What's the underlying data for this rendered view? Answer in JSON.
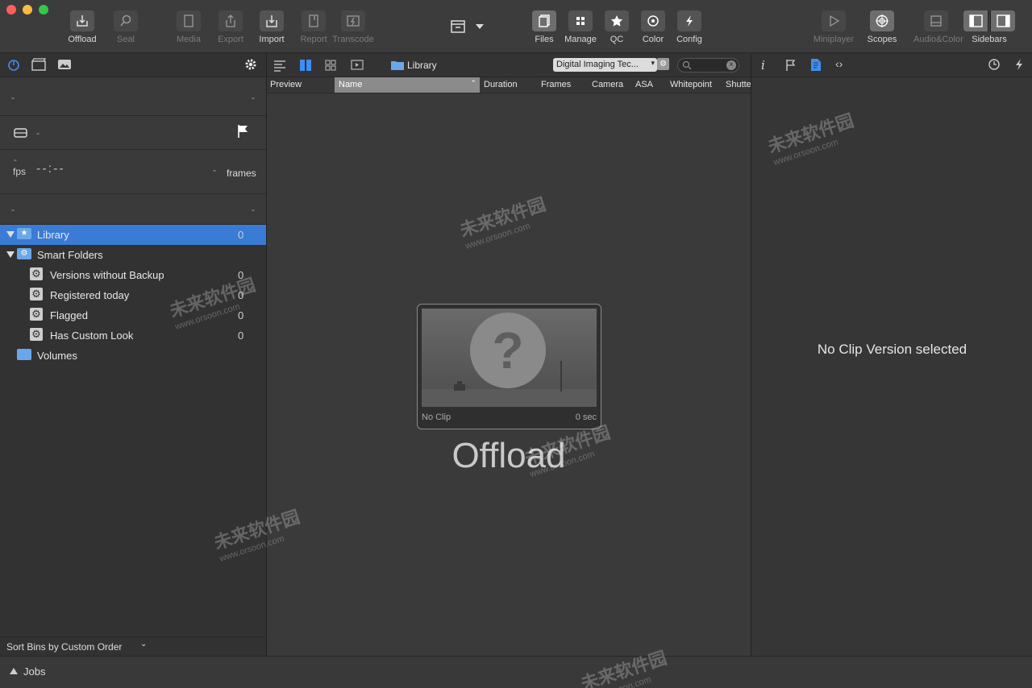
{
  "toolbar": {
    "offload": "Offload",
    "seal": "Seal",
    "media": "Media",
    "export": "Export",
    "import": "Import",
    "report": "Report",
    "transcode": "Transcode",
    "files": "Files",
    "manage": "Manage",
    "qc": "QC",
    "color": "Color",
    "config": "Config",
    "miniplayer": "Miniplayer",
    "scopes": "Scopes",
    "audio_color": "Audio&Color",
    "sidebars": "Sidebars"
  },
  "left_panel": {
    "dash": "-",
    "fps_label": "fps",
    "timecode": "--:--",
    "frames_label": "frames",
    "tree": [
      {
        "label": "Library",
        "count": "0"
      },
      {
        "label": "Smart Folders"
      },
      {
        "label": "Versions without Backup",
        "count": "0"
      },
      {
        "label": "Registered today",
        "count": "0"
      },
      {
        "label": "Flagged",
        "count": "0"
      },
      {
        "label": "Has Custom Look",
        "count": "0"
      },
      {
        "label": "Volumes"
      }
    ],
    "sort_label": "Sort Bins by Custom Order"
  },
  "middle": {
    "breadcrumb": "Library",
    "preset_select": "Digital Imaging Tec...",
    "columns": [
      "Preview",
      "Name",
      "Duration",
      "Frames",
      "Camera",
      "ASA",
      "Whitepoint",
      "Shutte"
    ],
    "placeholder": {
      "no_clip": "No Clip",
      "duration": "0 sec"
    },
    "big_title": "Offload"
  },
  "right_panel": {
    "empty_message": "No Clip Version selected"
  },
  "footer": {
    "jobs": "Jobs"
  },
  "watermark": {
    "title": "未来软件园",
    "url": "www.orsoon.com"
  },
  "colors": {
    "selection": "#3a7bd5",
    "accent_icon": "#3e8ef5"
  }
}
